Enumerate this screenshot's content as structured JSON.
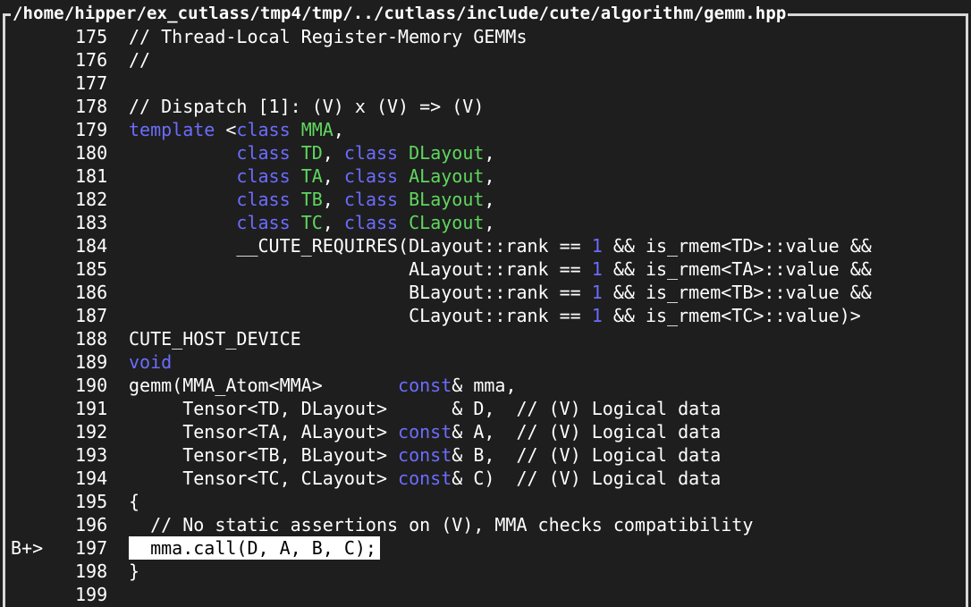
{
  "window": {
    "title": "/home/hipper/ex_cutlass/tmp4/tmp/../cutlass/include/cute/algorithm/gemm.hpp"
  },
  "colors": {
    "background": "#1e1e1e",
    "keyword": "#6c6cff",
    "type": "#5fd75f",
    "number": "#6c6cff",
    "text": "#ffffff",
    "frame": "#d8d8d8"
  },
  "source": {
    "lines": [
      {
        "no": "175",
        "marker": "",
        "current": false,
        "tokens": [
          {
            "k": "plain",
            "t": "// Thread-Local Register-Memory GEMMs"
          }
        ]
      },
      {
        "no": "176",
        "marker": "",
        "current": false,
        "tokens": [
          {
            "k": "plain",
            "t": "//"
          }
        ]
      },
      {
        "no": "177",
        "marker": "",
        "current": false,
        "tokens": []
      },
      {
        "no": "178",
        "marker": "",
        "current": false,
        "tokens": [
          {
            "k": "plain",
            "t": "// Dispatch [1]: (V) x (V) => (V)"
          }
        ]
      },
      {
        "no": "179",
        "marker": "",
        "current": false,
        "tokens": [
          {
            "k": "kw",
            "t": "template"
          },
          {
            "k": "plain",
            "t": " <"
          },
          {
            "k": "kw",
            "t": "class"
          },
          {
            "k": "plain",
            "t": " "
          },
          {
            "k": "type",
            "t": "MMA"
          },
          {
            "k": "plain",
            "t": ","
          }
        ]
      },
      {
        "no": "180",
        "marker": "",
        "current": false,
        "tokens": [
          {
            "k": "plain",
            "t": "          "
          },
          {
            "k": "kw",
            "t": "class"
          },
          {
            "k": "plain",
            "t": " "
          },
          {
            "k": "type",
            "t": "TD"
          },
          {
            "k": "plain",
            "t": ", "
          },
          {
            "k": "kw",
            "t": "class"
          },
          {
            "k": "plain",
            "t": " "
          },
          {
            "k": "type",
            "t": "DLayout"
          },
          {
            "k": "plain",
            "t": ","
          }
        ]
      },
      {
        "no": "181",
        "marker": "",
        "current": false,
        "tokens": [
          {
            "k": "plain",
            "t": "          "
          },
          {
            "k": "kw",
            "t": "class"
          },
          {
            "k": "plain",
            "t": " "
          },
          {
            "k": "type",
            "t": "TA"
          },
          {
            "k": "plain",
            "t": ", "
          },
          {
            "k": "kw",
            "t": "class"
          },
          {
            "k": "plain",
            "t": " "
          },
          {
            "k": "type",
            "t": "ALayout"
          },
          {
            "k": "plain",
            "t": ","
          }
        ]
      },
      {
        "no": "182",
        "marker": "",
        "current": false,
        "tokens": [
          {
            "k": "plain",
            "t": "          "
          },
          {
            "k": "kw",
            "t": "class"
          },
          {
            "k": "plain",
            "t": " "
          },
          {
            "k": "type",
            "t": "TB"
          },
          {
            "k": "plain",
            "t": ", "
          },
          {
            "k": "kw",
            "t": "class"
          },
          {
            "k": "plain",
            "t": " "
          },
          {
            "k": "type",
            "t": "BLayout"
          },
          {
            "k": "plain",
            "t": ","
          }
        ]
      },
      {
        "no": "183",
        "marker": "",
        "current": false,
        "tokens": [
          {
            "k": "plain",
            "t": "          "
          },
          {
            "k": "kw",
            "t": "class"
          },
          {
            "k": "plain",
            "t": " "
          },
          {
            "k": "type",
            "t": "TC"
          },
          {
            "k": "plain",
            "t": ", "
          },
          {
            "k": "kw",
            "t": "class"
          },
          {
            "k": "plain",
            "t": " "
          },
          {
            "k": "type",
            "t": "CLayout"
          },
          {
            "k": "plain",
            "t": ","
          }
        ]
      },
      {
        "no": "184",
        "marker": "",
        "current": false,
        "tokens": [
          {
            "k": "plain",
            "t": "          __CUTE_REQUIRES(DLayout::rank == "
          },
          {
            "k": "num",
            "t": "1"
          },
          {
            "k": "plain",
            "t": " && is_rmem<TD>::value &&"
          }
        ]
      },
      {
        "no": "185",
        "marker": "",
        "current": false,
        "tokens": [
          {
            "k": "plain",
            "t": "                          ALayout::rank == "
          },
          {
            "k": "num",
            "t": "1"
          },
          {
            "k": "plain",
            "t": " && is_rmem<TA>::value &&"
          }
        ]
      },
      {
        "no": "186",
        "marker": "",
        "current": false,
        "tokens": [
          {
            "k": "plain",
            "t": "                          BLayout::rank == "
          },
          {
            "k": "num",
            "t": "1"
          },
          {
            "k": "plain",
            "t": " && is_rmem<TB>::value &&"
          }
        ]
      },
      {
        "no": "187",
        "marker": "",
        "current": false,
        "tokens": [
          {
            "k": "plain",
            "t": "                          CLayout::rank == "
          },
          {
            "k": "num",
            "t": "1"
          },
          {
            "k": "plain",
            "t": " && is_rmem<TC>::value)>"
          }
        ]
      },
      {
        "no": "188",
        "marker": "",
        "current": false,
        "tokens": [
          {
            "k": "plain",
            "t": "CUTE_HOST_DEVICE"
          }
        ]
      },
      {
        "no": "189",
        "marker": "",
        "current": false,
        "tokens": [
          {
            "k": "kw",
            "t": "void"
          }
        ]
      },
      {
        "no": "190",
        "marker": "",
        "current": false,
        "tokens": [
          {
            "k": "plain",
            "t": "gemm(MMA_Atom<MMA>       "
          },
          {
            "k": "kw",
            "t": "const"
          },
          {
            "k": "plain",
            "t": "& mma,"
          }
        ]
      },
      {
        "no": "191",
        "marker": "",
        "current": false,
        "tokens": [
          {
            "k": "plain",
            "t": "     Tensor<TD, DLayout>      & D,  // (V) Logical data"
          }
        ]
      },
      {
        "no": "192",
        "marker": "",
        "current": false,
        "tokens": [
          {
            "k": "plain",
            "t": "     Tensor<TA, ALayout> "
          },
          {
            "k": "kw",
            "t": "const"
          },
          {
            "k": "plain",
            "t": "& A,  // (V) Logical data"
          }
        ]
      },
      {
        "no": "193",
        "marker": "",
        "current": false,
        "tokens": [
          {
            "k": "plain",
            "t": "     Tensor<TB, BLayout> "
          },
          {
            "k": "kw",
            "t": "const"
          },
          {
            "k": "plain",
            "t": "& B,  // (V) Logical data"
          }
        ]
      },
      {
        "no": "194",
        "marker": "",
        "current": false,
        "tokens": [
          {
            "k": "plain",
            "t": "     Tensor<TC, CLayout> "
          },
          {
            "k": "kw",
            "t": "const"
          },
          {
            "k": "plain",
            "t": "& C)  // (V) Logical data"
          }
        ]
      },
      {
        "no": "195",
        "marker": "",
        "current": false,
        "tokens": [
          {
            "k": "plain",
            "t": "{"
          }
        ]
      },
      {
        "no": "196",
        "marker": "",
        "current": false,
        "tokens": [
          {
            "k": "plain",
            "t": "  // No static assertions on (V), MMA checks compatibility"
          }
        ]
      },
      {
        "no": "197",
        "marker": "B+>",
        "current": true,
        "tokens": [
          {
            "k": "plain",
            "t": "  mma.call(D, A, B, C);"
          }
        ]
      },
      {
        "no": "198",
        "marker": "",
        "current": false,
        "tokens": [
          {
            "k": "plain",
            "t": "}"
          }
        ]
      },
      {
        "no": "199",
        "marker": "",
        "current": false,
        "tokens": []
      }
    ]
  }
}
